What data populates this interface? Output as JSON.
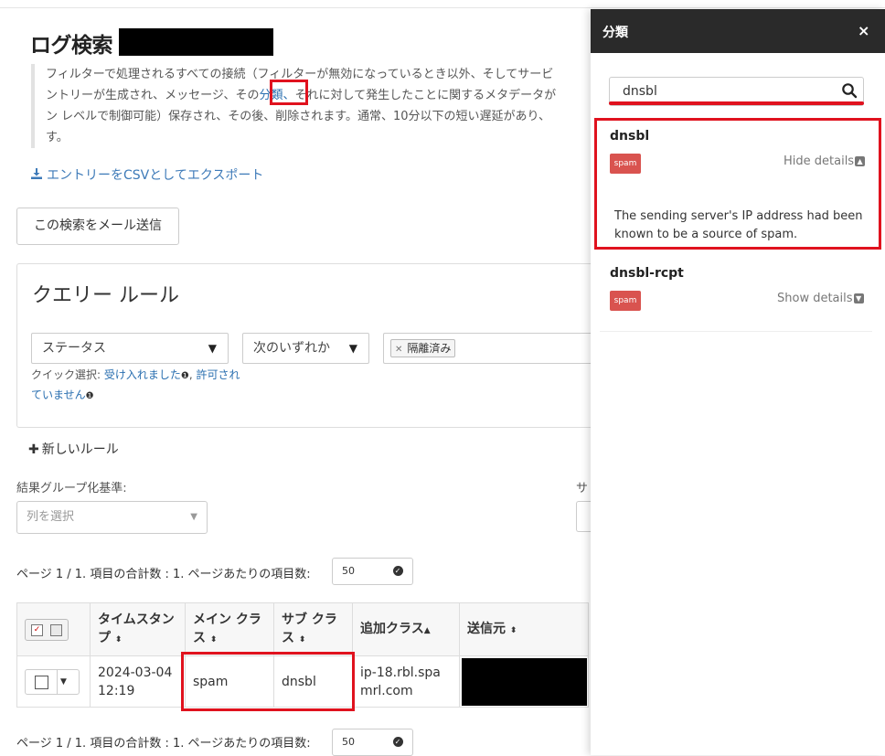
{
  "page": {
    "title": "ログ検索",
    "description_lines": [
      "フィルターで処理されるすべての接続（フィルターが無効になっているとき以外、そしてサービ",
      "ントリーが生成され、メッセージ、その",
      "それに対して発生したことに関するメタデータが",
      "ン レベルで制御可能）保存され、その後、削除されます。通常、10分以下の短い遅延があり、",
      "す。"
    ],
    "description_link": "分類、",
    "export_link": "エントリーをCSVとしてエクスポート",
    "email_button": "この検索をメール送信"
  },
  "query": {
    "title": "クエリー ルール",
    "field_select": "ステータス",
    "operator_select": "次のいずれか",
    "tags": [
      "隔離済み"
    ],
    "quick_select_label": "クイック選択:",
    "quick_select_options": [
      "受け入れました",
      "許可されていません"
    ],
    "new_rule": "新しいルール"
  },
  "grouping": {
    "label": "結果グループ化基準:",
    "placeholder": "列を選択",
    "right_label_fragment": "サ"
  },
  "pager": {
    "text": "ページ 1 / 1. 項目の合計数 : 1. ページあたりの項目数:",
    "per_page": "50"
  },
  "table": {
    "columns": [
      "タイムスタンプ",
      "メイン クラス",
      "サブ クラス",
      "追加クラス",
      "送信元"
    ],
    "rows": [
      {
        "timestamp": "2024-03-04 12:19",
        "main_class": "spam",
        "sub_class": "dnsbl",
        "extra_class": "ip-18.rbl.spamrl.com"
      }
    ]
  },
  "panel": {
    "title": "分類",
    "close": "×",
    "search_value": "dnsbl",
    "items": [
      {
        "name": "dnsbl",
        "badge": "spam",
        "toggle": "Hide details",
        "detail": "The sending server's IP address had been known to be a source of spam."
      },
      {
        "name": "dnsbl-rcpt",
        "badge": "spam",
        "toggle": "Show details"
      }
    ]
  },
  "colors": {
    "highlight": "#e0121e",
    "badge": "#d9534f",
    "panel_header": "#2a2a2a",
    "link": "#2a6fb0"
  }
}
